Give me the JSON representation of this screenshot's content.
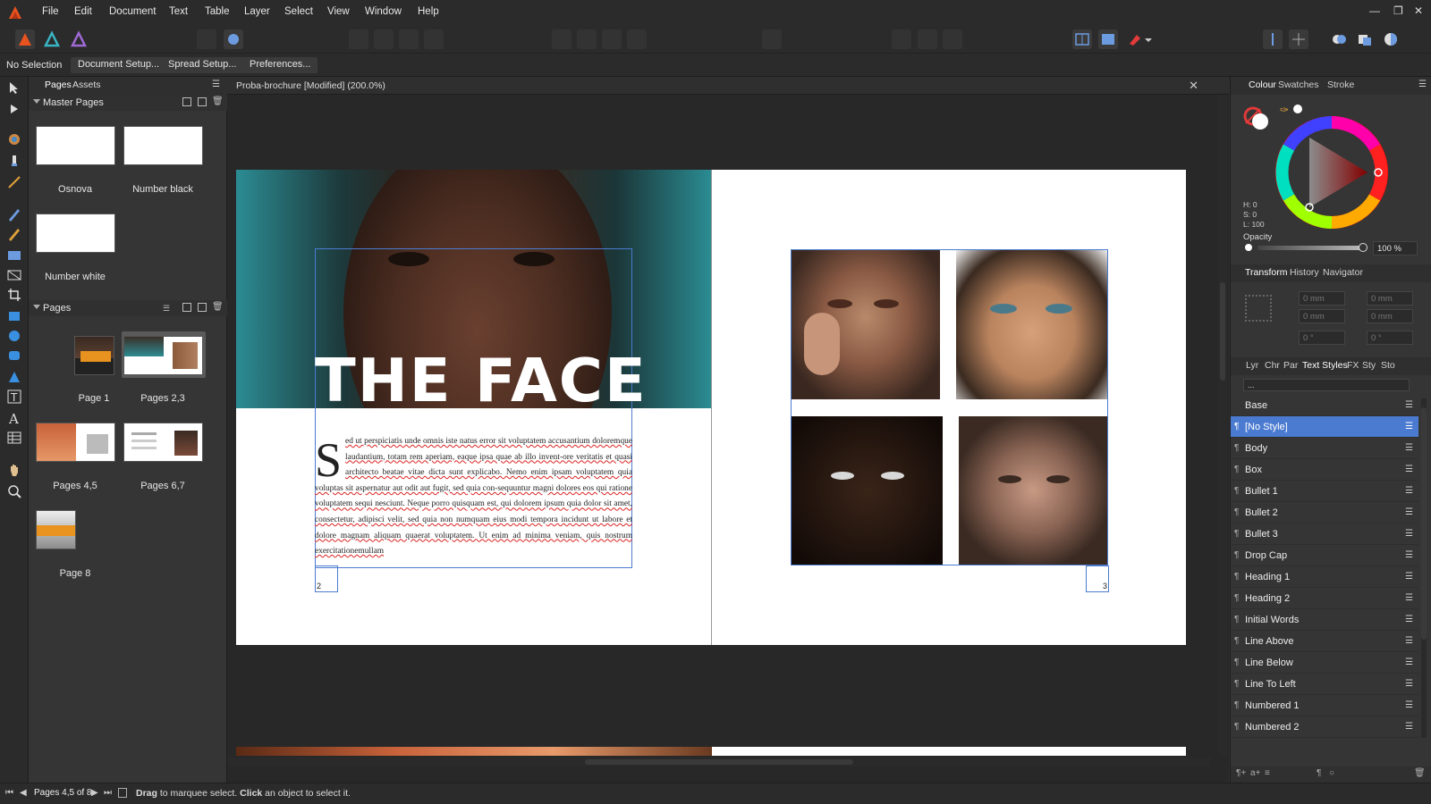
{
  "menubar": {
    "items": [
      "File",
      "Edit",
      "Document",
      "Text",
      "Table",
      "Layer",
      "Select",
      "View",
      "Window",
      "Help"
    ]
  },
  "context": {
    "selection_label": "No Selection",
    "buttons": [
      "Document Setup...",
      "Spread Setup...",
      "Preferences..."
    ]
  },
  "left_panel": {
    "tabs": [
      "Pages",
      "Assets"
    ],
    "master_pages_header": "Master Pages",
    "master_pages": [
      "Osnova",
      "Number black",
      "Number white"
    ],
    "pages_header": "Pages",
    "pages": [
      "Page 1",
      "Pages 2,3",
      "Pages 4,5",
      "Pages 6,7",
      "Page 8"
    ]
  },
  "document": {
    "title": "Proba-brochure [Modified] (200.0%)",
    "headline": "THE FACE",
    "drop_cap": "S",
    "body_text": "ed ut perspiciatis unde omnis iste natus error sit voluptatem accusantium doloremque laudantium, totam rem aperiam, eaque ipsa quae ab illo invent-ore veritatis et quasi architecto beatae vitae dicta sunt explicabo. Nemo enim ipsam voluptatem quia voluptas sit aspernatur aut odit aut fugit, sed quia con-sequuntur magni dolores eos qui ratione voluptatem sequi nesciunt. Neque porro quisquam est, qui dolorem ipsum quia dolor sit amet, consectetur, adipisci velit, sed quia non numquam eius modi tempora incidunt ut labore et dolore magnam aliquam quaerat voluptatem. Ut enim ad minima veniam, quis nostrum exercitationemullam",
    "page_number_left": "2",
    "page_number_right": "3"
  },
  "right_panel": {
    "top_tabs": [
      "Colour",
      "Swatches",
      "Stroke"
    ],
    "hsl": {
      "h": "H: 0",
      "s": "S: 0",
      "l": "L: 100"
    },
    "opacity_label": "Opacity",
    "opacity_value": "100 %",
    "mid_tabs": [
      "Transform",
      "History",
      "Navigator"
    ],
    "transform_values": [
      "0 mm",
      "0 mm",
      "0 mm",
      "0 mm",
      "0 °",
      "0 °"
    ],
    "style_tabs": [
      "Lyr",
      "Chr",
      "Par",
      "Text Styles",
      "FX",
      "Sty",
      "Sto"
    ],
    "style_search": "...",
    "styles": [
      "Base",
      "[No Style]",
      "Body",
      "Box",
      "Bullet 1",
      "Bullet 2",
      "Bullet 3",
      "Drop Cap",
      "Heading 1",
      "Heading 2",
      "Initial Words",
      "Line Above",
      "Line Below",
      "Line To Left",
      "Numbered 1",
      "Numbered 2"
    ],
    "selected_style": "[No Style]"
  },
  "status": {
    "page_indicator": "Pages 4,5 of 8",
    "hint_bold1": "Drag",
    "hint_text1": " to marquee select. ",
    "hint_bold2": "Click",
    "hint_text2": " an object to select it."
  },
  "colors": {
    "accent": "#4b7bd1",
    "brand": "#e8531f",
    "bg": "#2f2f2f"
  }
}
